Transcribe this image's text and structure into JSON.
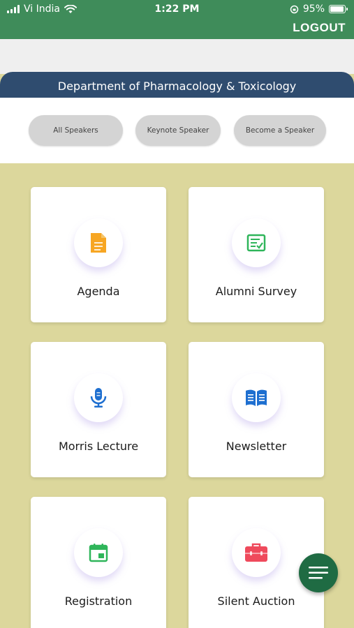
{
  "status_bar": {
    "carrier": "Vi India",
    "time": "1:22 PM",
    "battery": "95%",
    "battery_level": 0.95
  },
  "header": {
    "logout_label": "LOGOUT",
    "accent_color": "#3f8c5a"
  },
  "department": {
    "title": "Department of Pharmacology & Toxicology",
    "color": "#2f4c6f"
  },
  "speaker_tabs": [
    {
      "label": "All Speakers"
    },
    {
      "label": "Keynote Speaker"
    },
    {
      "label": "Become a Speaker"
    }
  ],
  "tiles": [
    {
      "label": "Agenda",
      "icon": "document-icon",
      "icon_color": "#f7a623"
    },
    {
      "label": "Alumni Survey",
      "icon": "survey-icon",
      "icon_color": "#2fb55a"
    },
    {
      "label": "Morris Lecture",
      "icon": "microphone-icon",
      "icon_color": "#1e6fd0"
    },
    {
      "label": "Newsletter",
      "icon": "book-icon",
      "icon_color": "#1e6fd0"
    },
    {
      "label": "Registration",
      "icon": "calendar-icon",
      "icon_color": "#2fb55a"
    },
    {
      "label": "Silent Auction",
      "icon": "briefcase-icon",
      "icon_color": "#ef4a5c"
    }
  ],
  "fab": {
    "icon": "menu-icon"
  }
}
